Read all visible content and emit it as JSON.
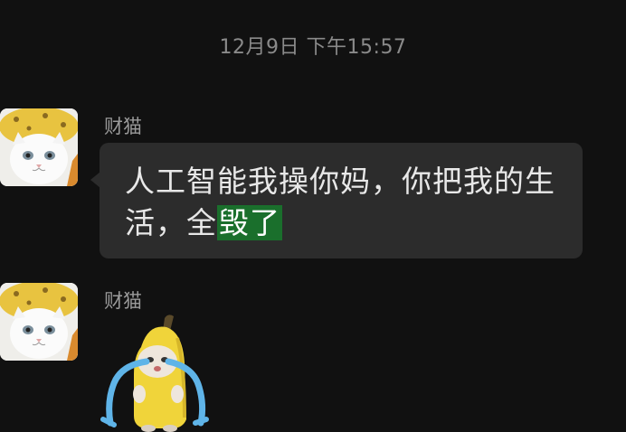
{
  "chat": {
    "timestamp": "12月9日 下午15:57",
    "messages": [
      {
        "sender": "财猫",
        "avatar_icon": "cat-in-banana-hat-icon",
        "type": "text",
        "text_part1": "人工智能我操你妈，你把我的生活，全",
        "text_highlight": "毁了",
        "highlight_color": "#1a6f2c"
      },
      {
        "sender": "财猫",
        "avatar_icon": "cat-in-banana-hat-icon",
        "type": "sticker",
        "sticker_icon": "crying-banana-cat-sticker"
      }
    ]
  }
}
